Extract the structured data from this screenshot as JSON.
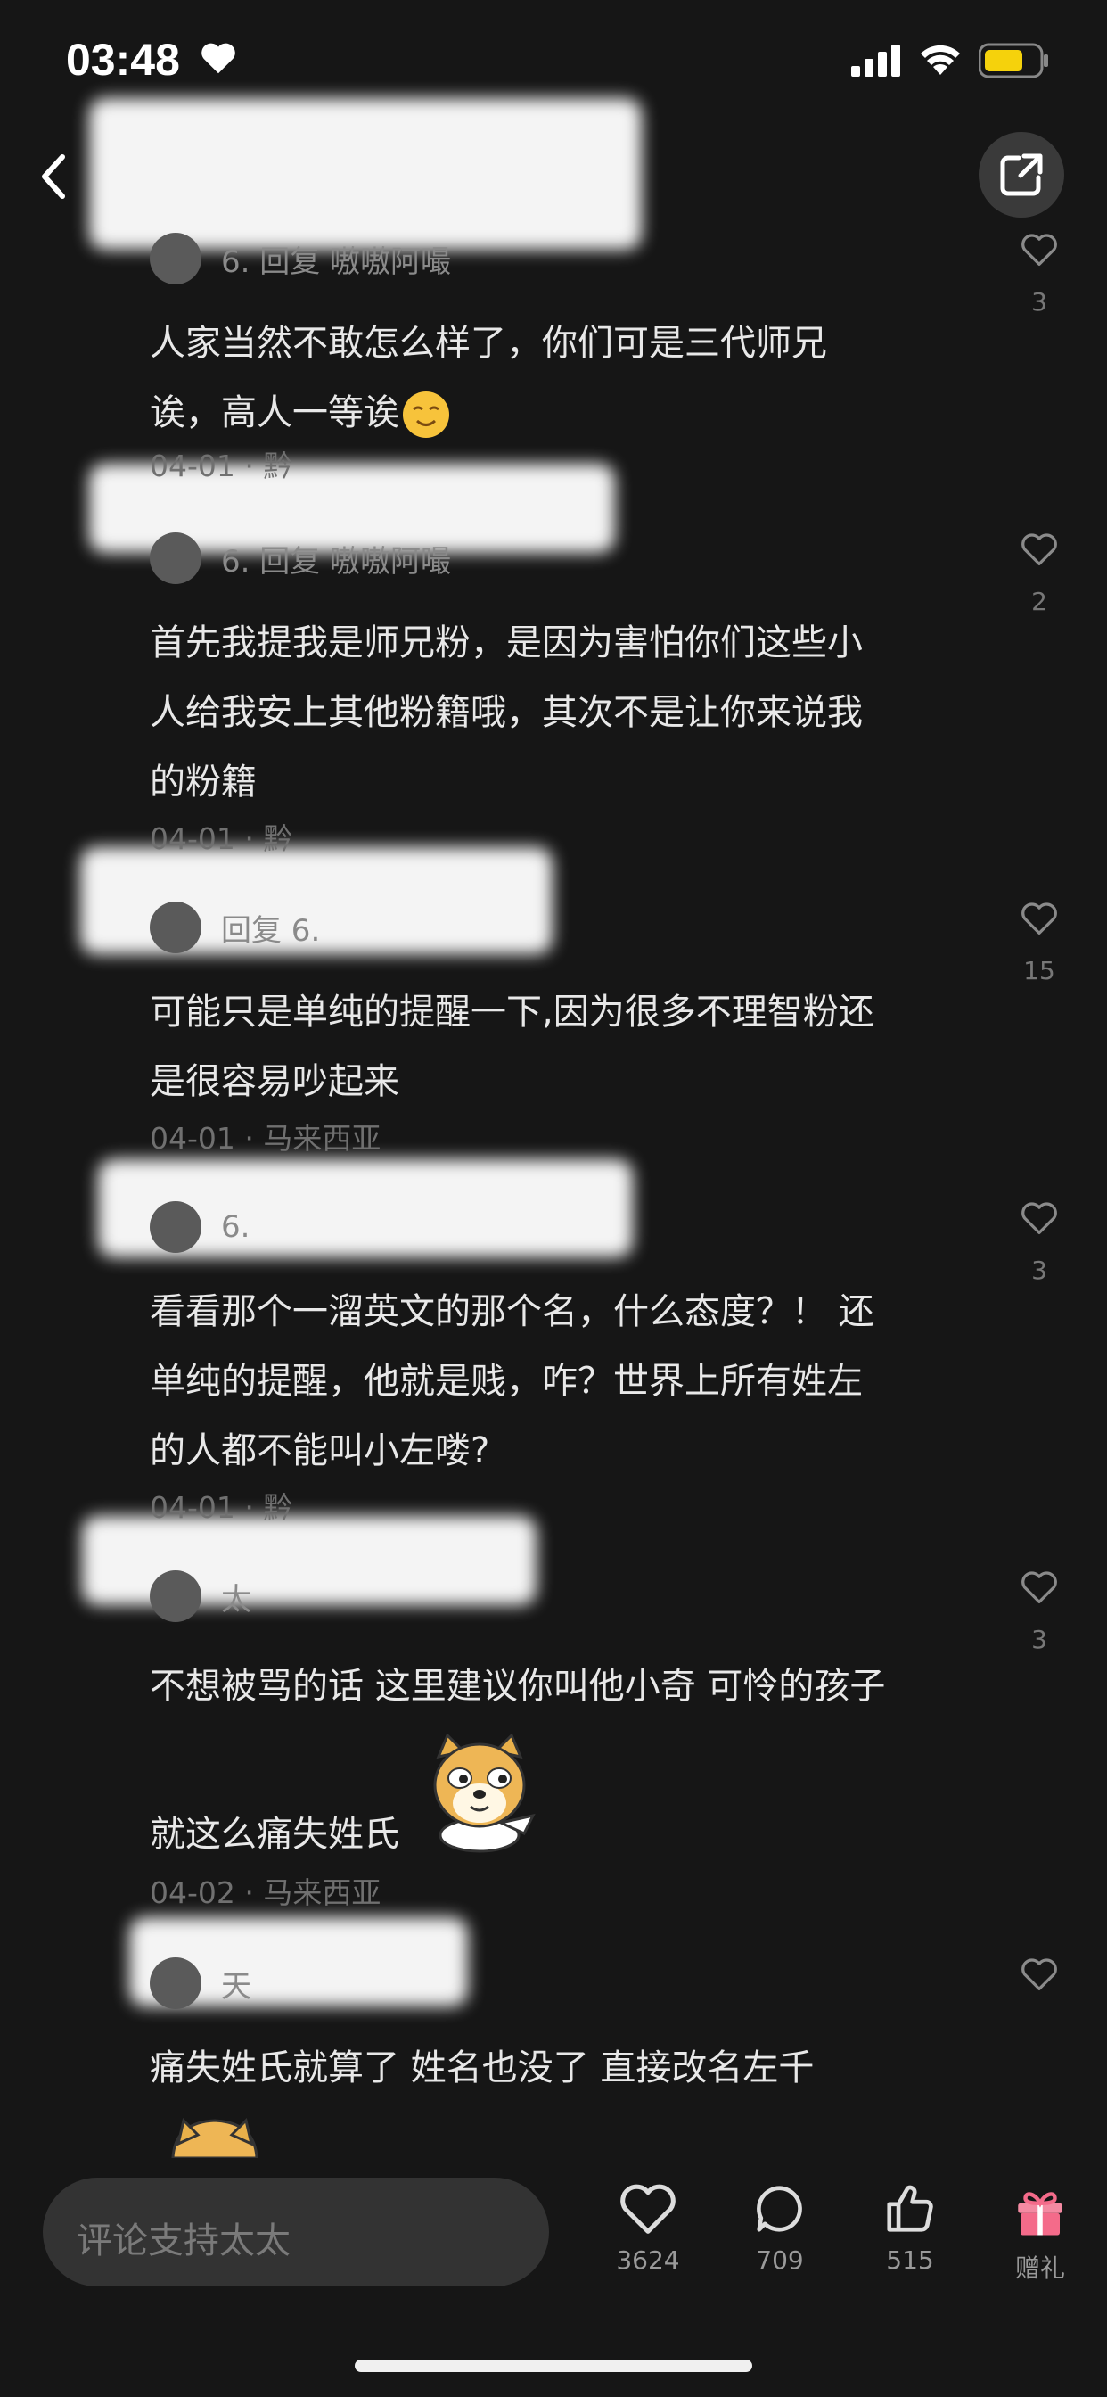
{
  "status_bar": {
    "time": "03:48"
  },
  "comments": [
    {
      "author": "6.      回复  嗷嗷阿嘬",
      "text_lines": [
        "人家当然不敢怎么样了，你们可是三代师兄",
        "诶，高人一等诶"
      ],
      "meta": "04-01 · 黔",
      "likes": "3"
    },
    {
      "author": "6.        回复  嗷嗷阿嘬",
      "text_lines": [
        "首先我提我是师兄粉，是因为害怕你们这些小",
        "人给我安上其他粉籍哦，其次不是让你来说我",
        "的粉籍"
      ],
      "meta": "04-01 · 黔",
      "likes": "2"
    },
    {
      "author": "回复  6.",
      "text_lines": [
        "可能只是单纯的提醒一下,因为很多不理智粉还",
        "是很容易吵起来"
      ],
      "meta": "04-01 · 马来西亚",
      "likes": "15"
    },
    {
      "author": "6.",
      "text_lines": [
        "看看那个一溜英文的那个名，什么态度？！ 还",
        "单纯的提醒，他就是贱，咋？世界上所有姓左",
        "的人都不能叫小左喽?"
      ],
      "meta": "04-01 · 黔",
      "likes": "3"
    },
    {
      "author": "太",
      "text_lines": [
        "不想被骂的话 这里建议你叫他小奇 可怜的孩子",
        "",
        "就这么痛失姓氏"
      ],
      "meta": "04-02 · 马来西亚",
      "likes": "3"
    },
    {
      "author": "天",
      "text_lines": [
        "痛失姓氏就算了 姓名也没了 直接改名左千"
      ],
      "meta": "",
      "likes": ""
    }
  ],
  "bottom_bar": {
    "input_placeholder": "评论支持太太",
    "like_count": "3624",
    "comment_count": "709",
    "thumb_count": "515",
    "gift_label": "赠礼"
  },
  "colors": {
    "background": "#161616",
    "battery": "#f5d20c",
    "gift": "#f46b8a"
  }
}
